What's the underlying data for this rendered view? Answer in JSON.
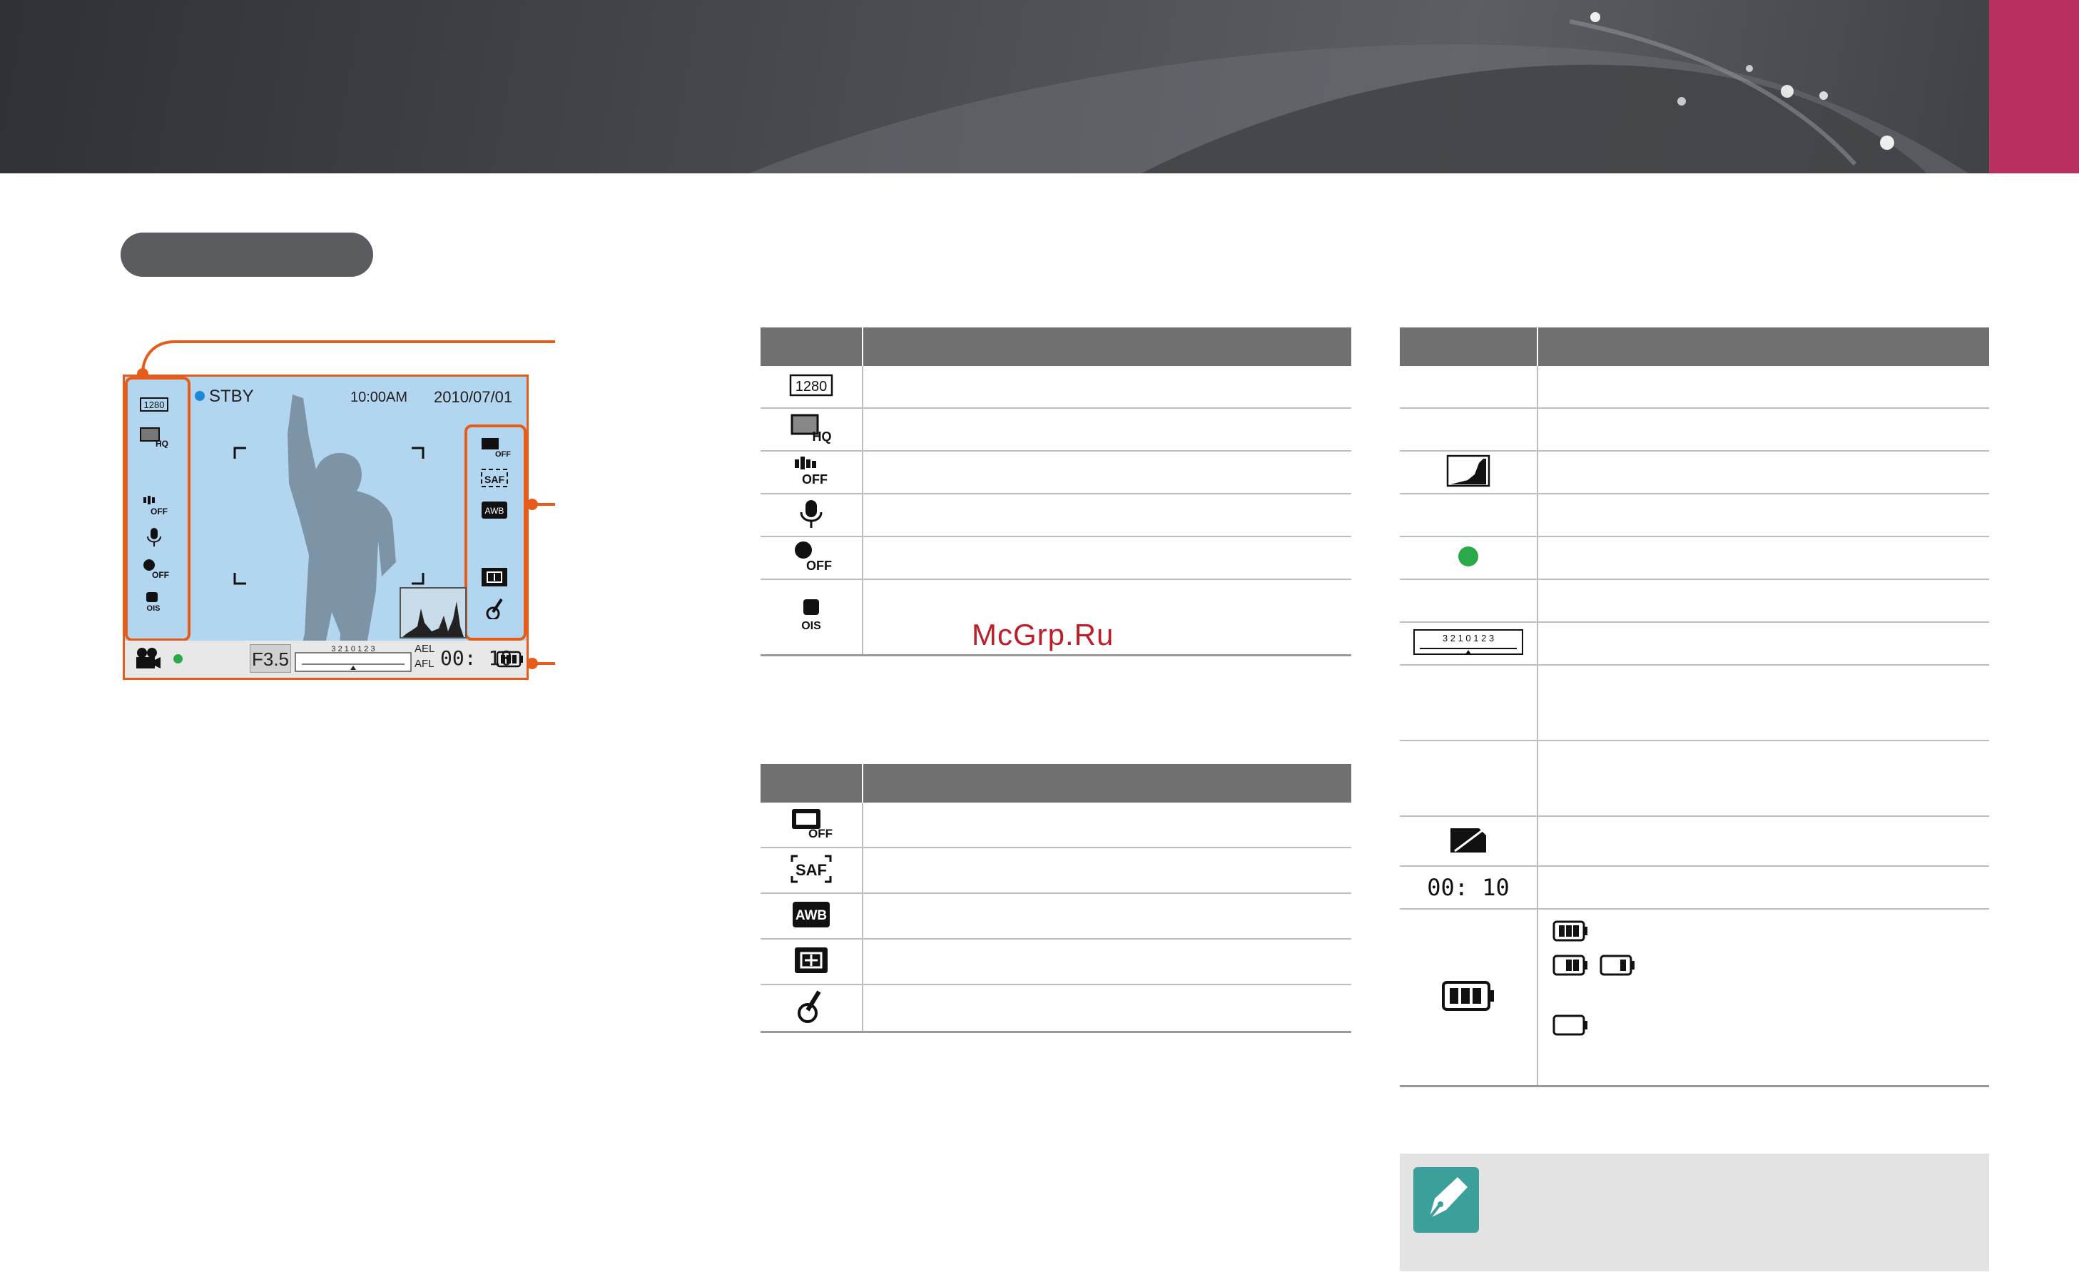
{
  "page": {
    "watermark": "McGrp.Ru"
  },
  "lcd": {
    "stby": "STBY",
    "time": "10:00AM",
    "date": "2010/07/01",
    "aperture": "F3.5",
    "ael": "AEL",
    "afl": "AFL",
    "rec_time": "00: 10",
    "exposure_scale": "3 2 1 0 1 2 3",
    "left_icons": [
      "movie-size-1280-icon",
      "quality-hq-icon",
      "wind-cut-off-icon",
      "voice-mic-icon",
      "fader-off-icon",
      "ois-icon"
    ],
    "right_icons": [
      "smart-range-off-icon",
      "saf-icon",
      "awb-icon",
      "metering-icon",
      "picture-wizard-icon"
    ],
    "bottom_icons": [
      "movie-mode-icon",
      "focus-dot-icon",
      "battery-full-icon"
    ]
  },
  "table_left_top": {
    "rows": [
      {
        "icon": "movie-size-1280-icon",
        "text": "1280"
      },
      {
        "icon": "quality-hq-icon",
        "text": "HQ"
      },
      {
        "icon": "wind-cut-off-icon",
        "text": "OFF"
      },
      {
        "icon": "voice-mic-icon",
        "text": ""
      },
      {
        "icon": "fader-off-icon",
        "text": "OFF"
      },
      {
        "icon": "ois-icon",
        "text": "OIS"
      }
    ]
  },
  "table_left_bottom": {
    "rows": [
      {
        "icon": "smart-range-off-icon",
        "text": "OFF"
      },
      {
        "icon": "saf-icon",
        "text": "SAF"
      },
      {
        "icon": "awb-icon",
        "text": "AWB"
      },
      {
        "icon": "metering-icon",
        "text": ""
      },
      {
        "icon": "picture-wizard-icon",
        "text": ""
      }
    ]
  },
  "table_right": {
    "rows": [
      {
        "icon": "",
        "text": ""
      },
      {
        "icon": "",
        "text": ""
      },
      {
        "icon": "histogram-icon",
        "text": ""
      },
      {
        "icon": "",
        "text": ""
      },
      {
        "icon": "focus-dot-icon",
        "text": ""
      },
      {
        "icon": "",
        "text": ""
      },
      {
        "icon": "exposure-scale-icon",
        "text": "3 2 1 0 1 2 3"
      },
      {
        "icon": "",
        "text": ""
      },
      {
        "icon": "",
        "text": ""
      },
      {
        "icon": "no-card-icon",
        "text": ""
      },
      {
        "icon": "rec-time-icon",
        "text": "00: 10"
      },
      {
        "icon": "battery-icon",
        "text": ""
      }
    ],
    "battery_states": [
      "battery-full-icon",
      "battery-half-icon",
      "battery-low-icon",
      "battery-empty-icon"
    ]
  },
  "colors": {
    "accent": "#e65c1b",
    "header_tab": "#b7305f",
    "table_header": "#707070",
    "lcd_bg": "#b3d6f0",
    "note_icon": "#3b9f9a",
    "focus_green": "#2aa84a"
  }
}
